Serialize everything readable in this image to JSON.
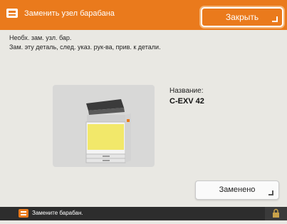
{
  "header": {
    "icon": "warning-panel-icon",
    "title": "Заменить узел барабана",
    "close_label": "Закрыть"
  },
  "message": {
    "line1": "Необх. зам. узл. бар.",
    "line2": "Зам. эту деталь, след. указ. рук-ва, прив. к детали."
  },
  "part": {
    "image": "printer-illustration",
    "name_label": "Название:",
    "name_value": "C-EXV 42"
  },
  "actions": {
    "replaced_label": "Заменено"
  },
  "statusbar": {
    "icon": "alert-icon",
    "text": "Замените барабан.",
    "right_icon": "lock-icon"
  },
  "colors": {
    "accent": "#ea7a1c",
    "background": "#e9e8e3",
    "statusbar": "#2d2d2d",
    "toner_yellow": "#f2e86a"
  }
}
